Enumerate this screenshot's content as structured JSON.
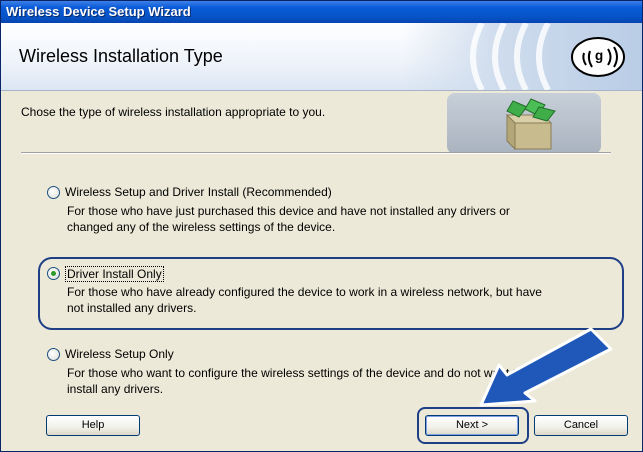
{
  "window": {
    "title": "Wireless Device Setup Wizard"
  },
  "header": {
    "title": "Wireless Installation Type",
    "logo_icon": "wireless-signal-logo"
  },
  "content": {
    "intro": "Chose the type of wireless installation appropriate to you.",
    "options": [
      {
        "label": "Wireless Setup and Driver Install (Recommended)",
        "desc_line1": "For those who have just purchased this device and have not installed any drivers or",
        "desc_line2": "changed any of the wireless settings of the device.",
        "selected": false
      },
      {
        "label": "Driver Install Only",
        "desc_line1": "For those who have already configured the device to work in a wireless network, but have",
        "desc_line2": "not installed any drivers.",
        "selected": true
      },
      {
        "label": "Wireless Setup Only",
        "desc_line1": "For those who want to configure the wireless settings of the device and do not want to",
        "desc_line2": "install any drivers.",
        "selected": false
      }
    ]
  },
  "buttons": {
    "help": "Help",
    "next": "Next >",
    "cancel": "Cancel"
  },
  "colors": {
    "titlebar": "#0654c8",
    "highlight": "#1e3f86",
    "arrow": "#1f58b8"
  }
}
